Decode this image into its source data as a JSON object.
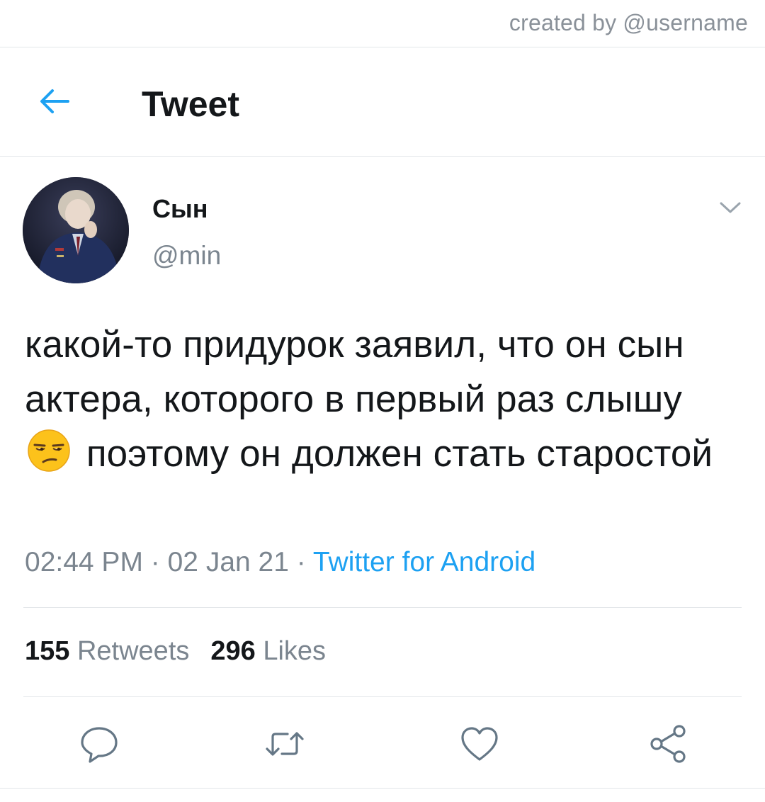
{
  "watermark": "created by @username",
  "header": {
    "back_icon": "arrow-left-icon",
    "title": "Tweet"
  },
  "tweet": {
    "author": {
      "name": "Сын",
      "handle": "@min",
      "avatar": "profile-photo"
    },
    "more_icon": "chevron-down-icon",
    "text_part1": "какой-то придурок заявил, что он сын актера, которого в первый раз слышу",
    "emoji": "unamused-face-emoji",
    "text_part2": "поэтому он должен стать старостой",
    "meta": {
      "time": "02:44 PM",
      "separator1": " · ",
      "date": "02 Jan 21",
      "separator2": " · ",
      "source": "Twitter for Android"
    },
    "stats": {
      "retweets_count": "155",
      "retweets_label": "Retweets",
      "likes_count": "296",
      "likes_label": "Likes"
    },
    "actions": {
      "reply_icon": "reply-bubble-icon",
      "retweet_icon": "retweet-icon",
      "like_icon": "heart-icon",
      "share_icon": "share-icon"
    }
  },
  "colors": {
    "accent": "#1da1f2",
    "text_primary": "#14171a",
    "text_secondary": "#7b858f",
    "divider": "#e3e6e9",
    "icon_gray": "#657786"
  }
}
